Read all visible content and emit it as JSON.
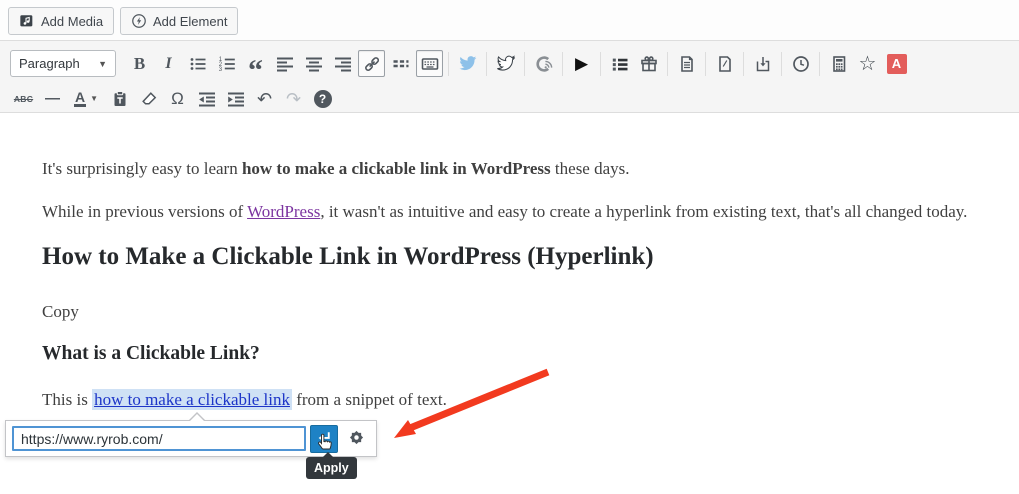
{
  "top_bar": {
    "add_media_label": "Add Media",
    "add_element_label": "Add Element"
  },
  "toolbar": {
    "format_value": "Paragraph",
    "row1": [
      {
        "name": "bold-button",
        "icon": "bold"
      },
      {
        "name": "italic-button",
        "icon": "italic"
      },
      {
        "name": "bullet-list-button",
        "icon": "bullet-list"
      },
      {
        "name": "numbered-list-button",
        "icon": "numbered-list"
      },
      {
        "name": "blockquote-button",
        "icon": "blockquote"
      },
      {
        "name": "align-left-button",
        "icon": "align-left"
      },
      {
        "name": "align-center-button",
        "icon": "align-center"
      },
      {
        "name": "align-right-button",
        "icon": "align-right"
      },
      {
        "name": "link-button",
        "icon": "link",
        "active": true
      },
      {
        "name": "read-more-button",
        "icon": "more-tag"
      },
      {
        "name": "toolbar-toggle-button",
        "icon": "keyboard",
        "active": true
      },
      {
        "sep": true
      },
      {
        "name": "twitter-share-button",
        "icon": "twitter-solid"
      },
      {
        "sep": true
      },
      {
        "name": "click-to-tweet-button",
        "icon": "twitter-outline"
      },
      {
        "sep": true
      },
      {
        "name": "revive-social-button",
        "icon": "c-signal"
      },
      {
        "sep": true
      },
      {
        "name": "insert-video-button",
        "icon": "play"
      },
      {
        "sep": true
      },
      {
        "name": "table-of-contents-button",
        "icon": "toc-list"
      },
      {
        "name": "giveaway-button",
        "icon": "gift"
      },
      {
        "sep": true
      },
      {
        "name": "document-button",
        "icon": "document"
      },
      {
        "sep": true
      },
      {
        "name": "draft-document-button",
        "icon": "document-slash"
      },
      {
        "sep": true
      },
      {
        "name": "download-button",
        "icon": "download"
      },
      {
        "sep": true
      },
      {
        "name": "schedule-button",
        "icon": "clock"
      },
      {
        "sep": true
      },
      {
        "name": "calculator-button",
        "icon": "calculator"
      },
      {
        "name": "star-button",
        "icon": "star"
      },
      {
        "name": "highlight-a-button",
        "icon": "letter-a-red"
      }
    ],
    "row2": [
      {
        "name": "strikethrough-button",
        "icon": "strikethrough"
      },
      {
        "name": "horizontal-rule-button",
        "icon": "hr"
      },
      {
        "name": "text-color-button",
        "icon": "text-color",
        "wide": true
      },
      {
        "name": "paste-as-text-button",
        "icon": "paste-text"
      },
      {
        "name": "clear-formatting-button",
        "icon": "eraser"
      },
      {
        "name": "special-character-button",
        "icon": "omega"
      },
      {
        "name": "outdent-button",
        "icon": "outdent"
      },
      {
        "name": "indent-button",
        "icon": "indent"
      },
      {
        "name": "undo-button",
        "icon": "undo"
      },
      {
        "name": "redo-button",
        "icon": "redo",
        "disabled": true
      },
      {
        "name": "help-button",
        "icon": "help"
      }
    ]
  },
  "content": {
    "p1_prefix": "It's surprisingly easy to learn ",
    "p1_bold": "how to make a clickable link in WordPress",
    "p1_suffix": " these days.",
    "p2_prefix": "While in previous versions of ",
    "p2_link": "WordPress",
    "p2_suffix": ", it wasn't as intuitive and easy to create a hyperlink from existing text, that's all changed today.",
    "h1": "How to Make a Clickable Link in WordPress (Hyperlink)",
    "copy": "Copy",
    "h2": "What is a Clickable Link?",
    "p3_prefix": "This is ",
    "p3_selected_link": "how to make a clickable link",
    "p3_suffix": " from a snippet of text."
  },
  "link_popup": {
    "url_value": "https://www.ryrob.com/",
    "tooltip": "Apply"
  },
  "colors": {
    "apply_blue": "#1e82c5",
    "input_focus_blue": "#4f94d4",
    "link_blue": "#1d35c8",
    "visited_purple": "#7c35a0",
    "selection_highlight": "#cfe1f5",
    "arrow_red": "#f23a1f",
    "letter_a_red": "#e35d5b",
    "toolbar_bg": "#f5f5f5",
    "icon_gray": "#50575e",
    "twitter_blue": "#8ec1e9",
    "tooltip_bg": "#32373c"
  }
}
